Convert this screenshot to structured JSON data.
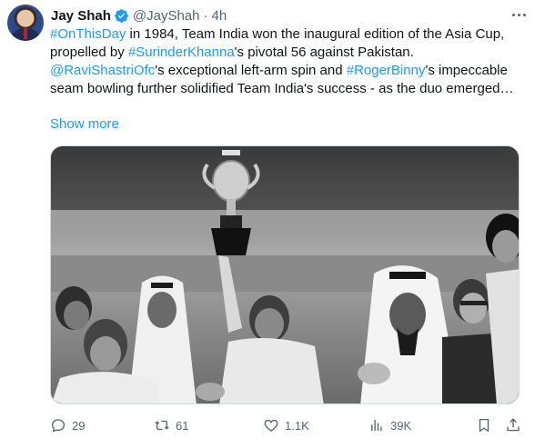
{
  "tweet": {
    "author_name": "Jay Shah",
    "handle": "@JayShah",
    "separator": "·",
    "time": "4h",
    "text_segments": [
      {
        "text": "#OnThisDay",
        "link": true
      },
      {
        "text": " in 1984, Team India won the inaugural edition of the Asia Cup, propelled by ",
        "link": false
      },
      {
        "text": "#SurinderKhanna",
        "link": true
      },
      {
        "text": "'s pivotal 56 against Pakistan. ",
        "link": false
      },
      {
        "text": "@RaviShastriOfc",
        "link": true
      },
      {
        "text": "'s exceptional left-arm spin and ",
        "link": false
      },
      {
        "text": "#RogerBinny",
        "link": true
      },
      {
        "text": "'s impeccable seam bowling further solidified Team India's success - as the duo emerged…",
        "link": false
      }
    ],
    "show_more": "Show more"
  },
  "image": {
    "description_icon": "trophy-celebration-photo",
    "palette": "black-and-white"
  },
  "actions": {
    "replies": "29",
    "reposts": "61",
    "likes": "1.1K",
    "views": "39K"
  },
  "colors": {
    "link": "#1d9bf0",
    "text": "#0f1419",
    "muted": "#536471",
    "verified": "#1d9bf0"
  }
}
